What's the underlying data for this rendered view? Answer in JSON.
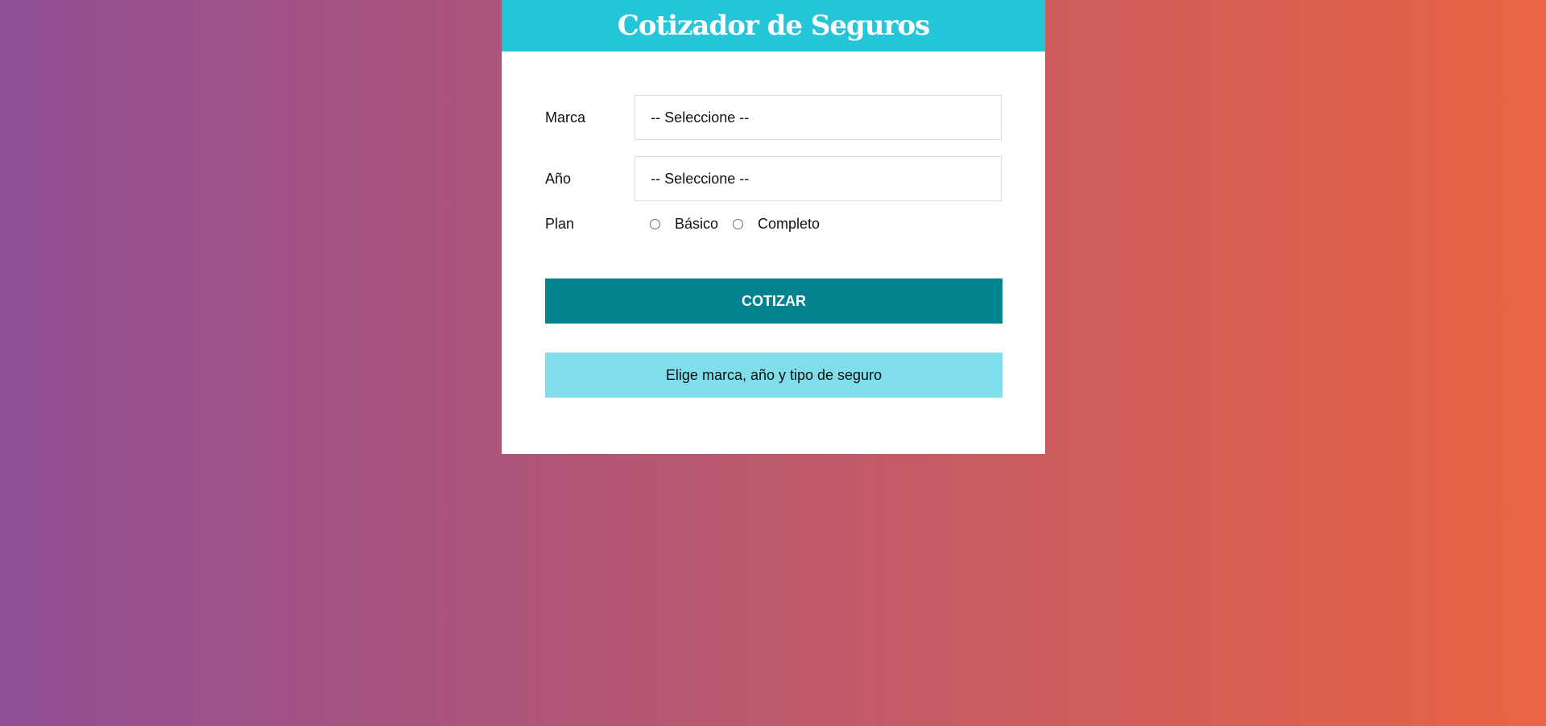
{
  "header": {
    "title": "Cotizador de Seguros"
  },
  "form": {
    "marca": {
      "label": "Marca",
      "selected": "-- Seleccione --"
    },
    "anio": {
      "label": "Año",
      "selected": "-- Seleccione --"
    },
    "plan": {
      "label": "Plan",
      "options": [
        "Básico",
        "Completo"
      ]
    },
    "submit_label": "COTIZAR",
    "message": "Elige marca, año y tipo de seguro"
  },
  "colors": {
    "header_bg": "#26c6da",
    "button_bg": "#00838f",
    "message_bg": "#80deea",
    "gradient_start": "#904e95",
    "gradient_end": "#e96443"
  }
}
